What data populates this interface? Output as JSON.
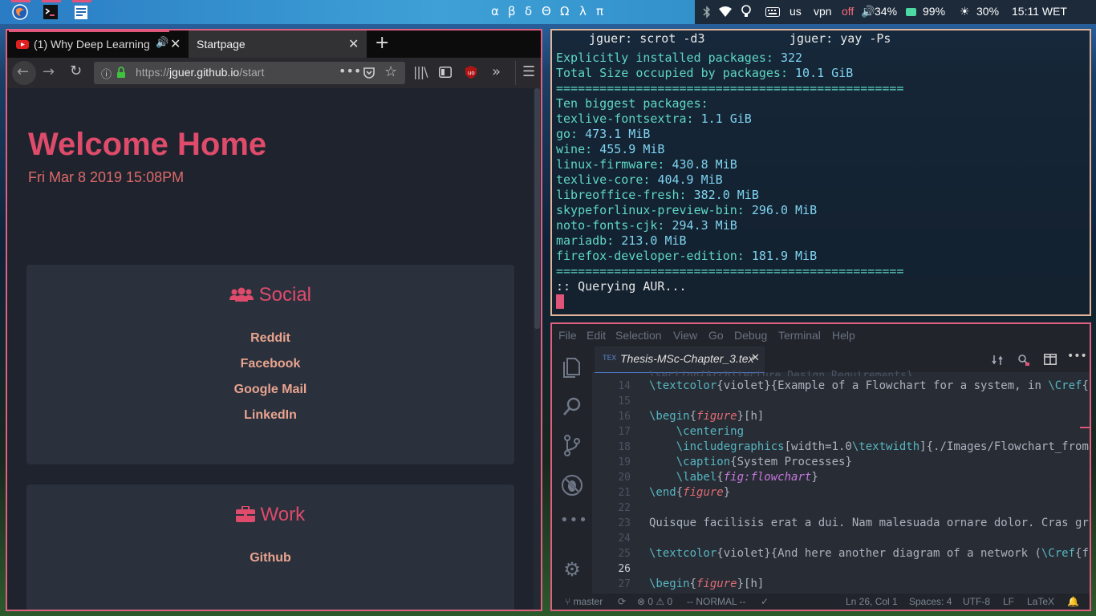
{
  "topbar": {
    "workspaces": [
      "α",
      "β",
      "δ",
      "Θ",
      "Ω",
      "λ",
      "π"
    ],
    "keyboard_layout": "us",
    "vpn_label": "vpn",
    "vpn_state": "off",
    "volume": "34%",
    "battery": "99%",
    "brightness": "30%",
    "clock": "15:11 WET"
  },
  "browser": {
    "tabs": [
      {
        "label": "(1) Why Deep Learning"
      },
      {
        "label": "Startpage"
      }
    ],
    "url_prefix": "https://",
    "url_host": "jguer.github.io",
    "url_path": "/start",
    "page": {
      "title": "Welcome Home",
      "datetime": "Fri Mar 8 2019 15:08PM",
      "sections": [
        {
          "heading": "Social",
          "links": [
            "Reddit",
            "Facebook",
            "Google Mail",
            "LinkedIn"
          ]
        },
        {
          "heading": "Work",
          "links": [
            "Github"
          ]
        }
      ]
    }
  },
  "terminal": {
    "tabs": [
      "jguer: scrot -d3",
      "jguer: yay -Ps"
    ],
    "lines": [
      {
        "k": "Explicitly installed packages: ",
        "v": "322"
      },
      {
        "k": "Total Size occupied by packages: ",
        "v": "10.1 GiB"
      },
      {
        "k": "================================================",
        "v": ""
      },
      {
        "k": "Ten biggest packages:",
        "v": ""
      },
      {
        "k": "texlive-fontsextra: ",
        "v": "1.1 GiB"
      },
      {
        "k": "go: ",
        "v": "473.1 MiB"
      },
      {
        "k": "wine: ",
        "v": "455.9 MiB"
      },
      {
        "k": "linux-firmware: ",
        "v": "430.8 MiB"
      },
      {
        "k": "texlive-core: ",
        "v": "404.9 MiB"
      },
      {
        "k": "libreoffice-fresh: ",
        "v": "382.0 MiB"
      },
      {
        "k": "skypeforlinux-preview-bin: ",
        "v": "296.0 MiB"
      },
      {
        "k": "noto-fonts-cjk: ",
        "v": "294.3 MiB"
      },
      {
        "k": "mariadb: ",
        "v": "213.0 MiB"
      },
      {
        "k": "firefox-developer-edition: ",
        "v": "181.9 MiB"
      },
      {
        "k": "================================================",
        "v": ""
      },
      {
        "k": ":: Querying AUR...",
        "v": ""
      }
    ]
  },
  "vscode": {
    "menu": [
      "File",
      "Edit",
      "Selection",
      "View",
      "Go",
      "Debug",
      "Terminal",
      "Help"
    ],
    "tab_label": "Thesis-MSc-Chapter_3.tex",
    "line_numbers": [
      "14",
      "15",
      "16",
      "17",
      "18",
      "19",
      "20",
      "21",
      "22",
      "23",
      "24",
      "25",
      "26",
      "27"
    ],
    "code": [
      "\\textcolor{violet}{Example of a Flowchart for a system, in \\Cref{",
      "",
      "\\begin{figure}[h]",
      "    \\centering",
      "    \\includegraphics[width=1.0\\textwidth]{./Images/Flowchart_from",
      "    \\caption{System Processes}",
      "    \\label{fig:flowchart}",
      "\\end{figure}",
      "",
      "Quisque facilisis erat a dui. Nam malesuada ornare dolor. Cras gr",
      "",
      "\\textcolor{violet}{And here another diagram of a network (\\Cref{f",
      "",
      "\\begin{figure}[h]"
    ],
    "status": {
      "branch": "master",
      "errors": "0",
      "warnings": "0",
      "mode": "-- NORMAL --",
      "position": "Ln 26, Col 1",
      "spaces": "Spaces: 4",
      "encoding": "UTF-8",
      "eol": "LF",
      "language": "LaTeX"
    }
  },
  "colors": {
    "accent": "#de4b6b",
    "link": "#e8a48e",
    "terminal_key": "#5fd7c5",
    "terminal_value": "#7fd3f0",
    "vpn_off": "#ff6a7a"
  }
}
